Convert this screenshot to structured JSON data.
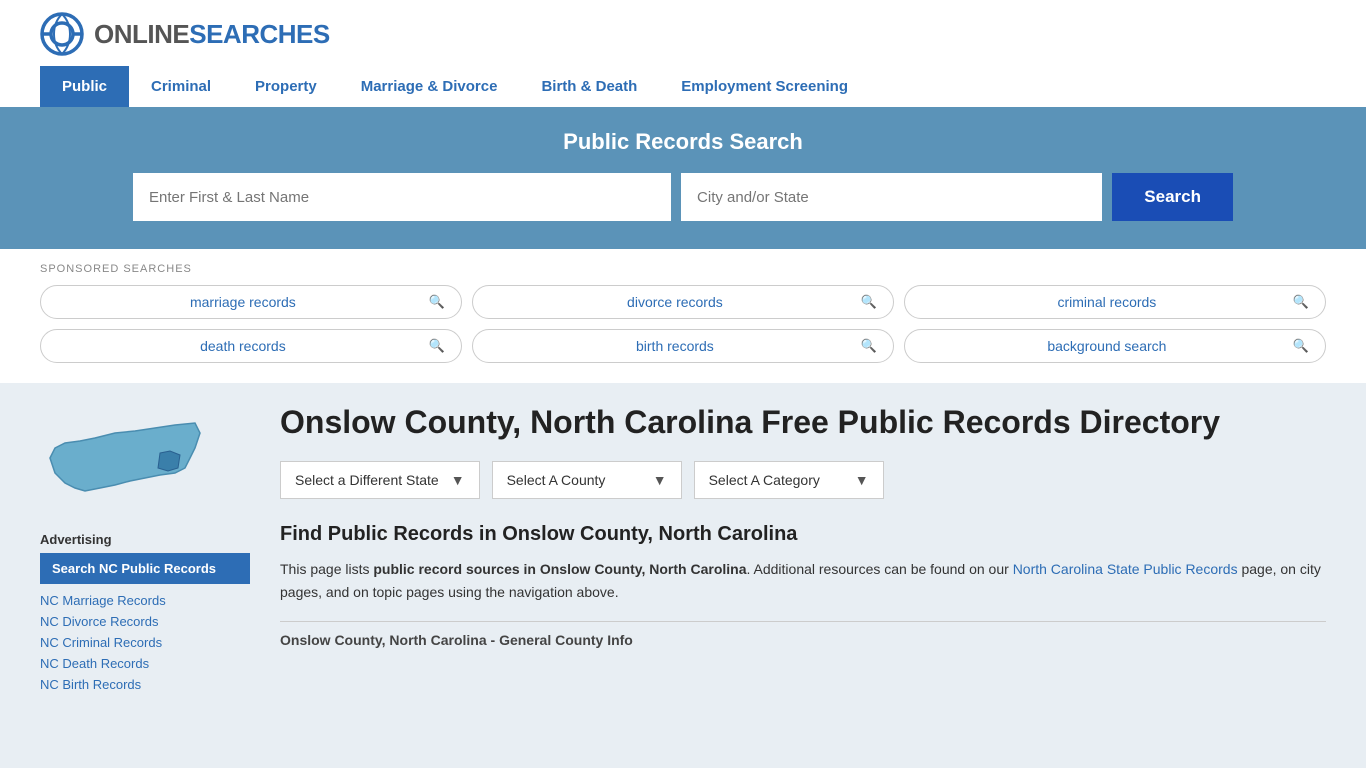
{
  "site": {
    "logo_online": "ONLINE",
    "logo_searches": "SEARCHES"
  },
  "nav": {
    "items": [
      {
        "label": "Public",
        "active": true
      },
      {
        "label": "Criminal",
        "active": false
      },
      {
        "label": "Property",
        "active": false
      },
      {
        "label": "Marriage & Divorce",
        "active": false
      },
      {
        "label": "Birth & Death",
        "active": false
      },
      {
        "label": "Employment Screening",
        "active": false
      }
    ]
  },
  "search_section": {
    "title": "Public Records Search",
    "name_placeholder": "Enter First & Last Name",
    "location_placeholder": "City and/or State",
    "button_label": "Search"
  },
  "sponsored": {
    "label": "SPONSORED SEARCHES",
    "items": [
      {
        "label": "marriage records"
      },
      {
        "label": "divorce records"
      },
      {
        "label": "criminal records"
      },
      {
        "label": "death records"
      },
      {
        "label": "birth records"
      },
      {
        "label": "background search"
      }
    ]
  },
  "page": {
    "title": "Onslow County, North Carolina Free Public Records Directory",
    "dropdowns": {
      "state": "Select a Different State",
      "county": "Select A County",
      "category": "Select A Category"
    },
    "find_heading": "Find Public Records in Onslow County, North Carolina",
    "description_part1": "This page lists ",
    "description_bold": "public record sources in Onslow County, North Carolina",
    "description_part2": ". Additional resources can be found on our ",
    "description_link": "North Carolina State Public Records",
    "description_part3": " page, on city pages, and on topic pages using the navigation above.",
    "county_info_label": "Onslow County, North Carolina - General County Info"
  },
  "sidebar": {
    "advertising_label": "Advertising",
    "ad_active_label": "Search NC Public Records",
    "links": [
      "NC Marriage Records",
      "NC Divorce Records",
      "NC Criminal Records",
      "NC Death Records",
      "NC Birth Records"
    ]
  }
}
